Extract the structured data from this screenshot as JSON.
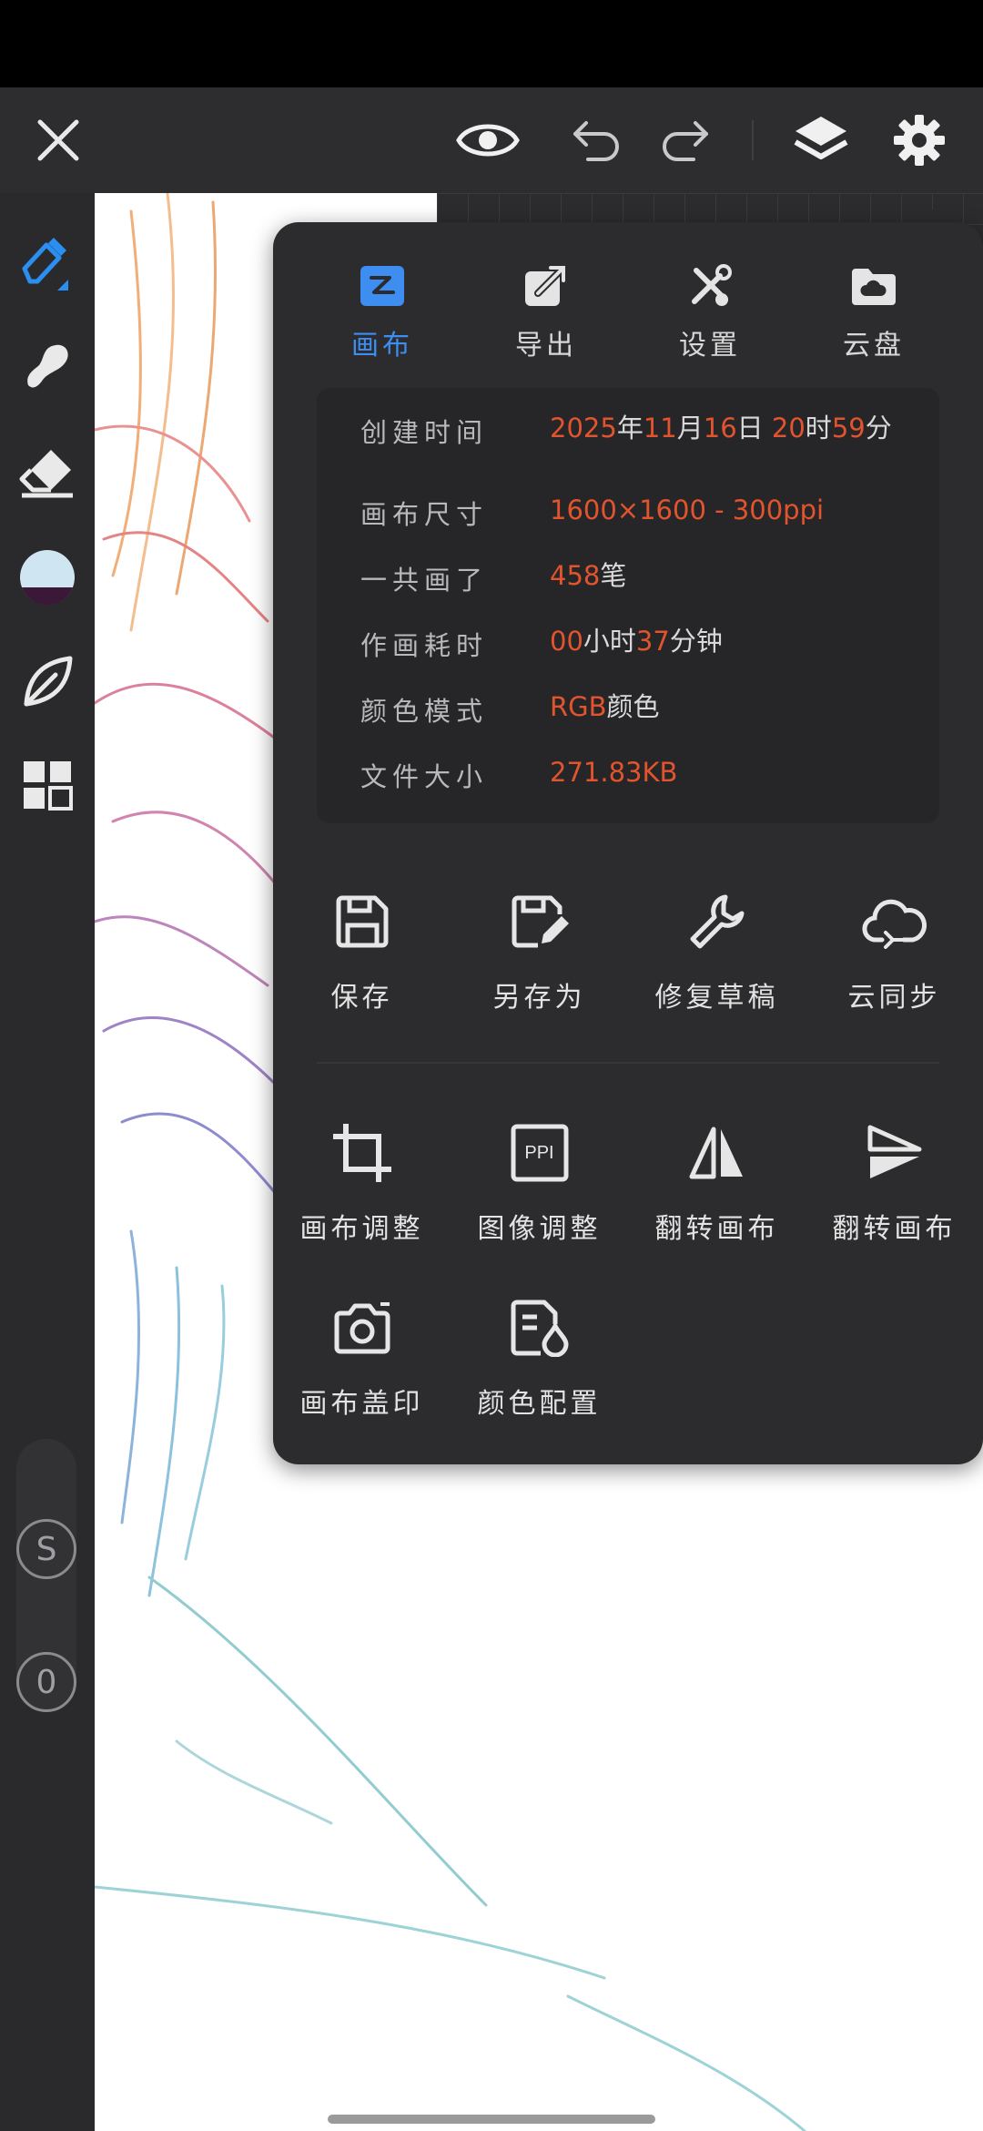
{
  "toolbar": {
    "close": "close-icon",
    "preview": "eye-icon",
    "undo": "undo-icon",
    "redo": "redo-icon",
    "layers": "layers-icon",
    "settings": "gear-icon"
  },
  "side_tools": [
    "pen-icon",
    "smudge-icon",
    "eraser-icon",
    "color-swatch",
    "leaf-icon",
    "grid-icon"
  ],
  "side_badges": {
    "s": "S",
    "zero": "0"
  },
  "panel": {
    "tabs": [
      {
        "label": "画布",
        "icon": "canvas-icon",
        "active": true
      },
      {
        "label": "导出",
        "icon": "export-icon",
        "active": false
      },
      {
        "label": "设置",
        "icon": "tools-icon",
        "active": false
      },
      {
        "label": "云盘",
        "icon": "cloud-folder-icon",
        "active": false
      }
    ],
    "info": {
      "created": {
        "label": "创建时间",
        "y1": "2025",
        "y2": "年",
        "m1": "11",
        "m2": "月",
        "d1": "16",
        "d2": "日",
        "h1": "20",
        "h2": "时",
        "mi1": "59",
        "mi2": "分"
      },
      "size": {
        "label": "画布尺寸",
        "value": "1600×1600 - 300ppi"
      },
      "strokes": {
        "label": "一共画了",
        "num": "458",
        "unit": "笔"
      },
      "duration": {
        "label": "作画耗时",
        "h": "00",
        "hu": "小时",
        "m": "37",
        "mu": "分钟"
      },
      "color_mode": {
        "label": "颜色模式",
        "value": "RGB",
        "unit": "颜色"
      },
      "file_size": {
        "label": "文件大小",
        "value": "271.83KB"
      }
    },
    "actions_row1": [
      {
        "label": "保存",
        "icon": "save-icon"
      },
      {
        "label": "另存为",
        "icon": "save-as-icon"
      },
      {
        "label": "修复草稿",
        "icon": "wrench-icon"
      },
      {
        "label": "云同步",
        "icon": "cloud-sync-icon"
      }
    ],
    "actions_row2": [
      {
        "label": "画布调整",
        "icon": "crop-icon"
      },
      {
        "label": "图像调整",
        "icon": "ppi-icon",
        "badge": "PPI"
      },
      {
        "label": "翻转画布",
        "icon": "flip-horizontal-icon"
      },
      {
        "label": "翻转画布",
        "icon": "flip-vertical-icon"
      }
    ],
    "actions_row3": [
      {
        "label": "画布盖印",
        "icon": "camera-icon"
      },
      {
        "label": "颜色配置",
        "icon": "color-profile-icon"
      }
    ]
  },
  "colors": {
    "accent": "#3d8ef0",
    "highlight": "#e2542e",
    "panel": "#2c2c2e"
  }
}
